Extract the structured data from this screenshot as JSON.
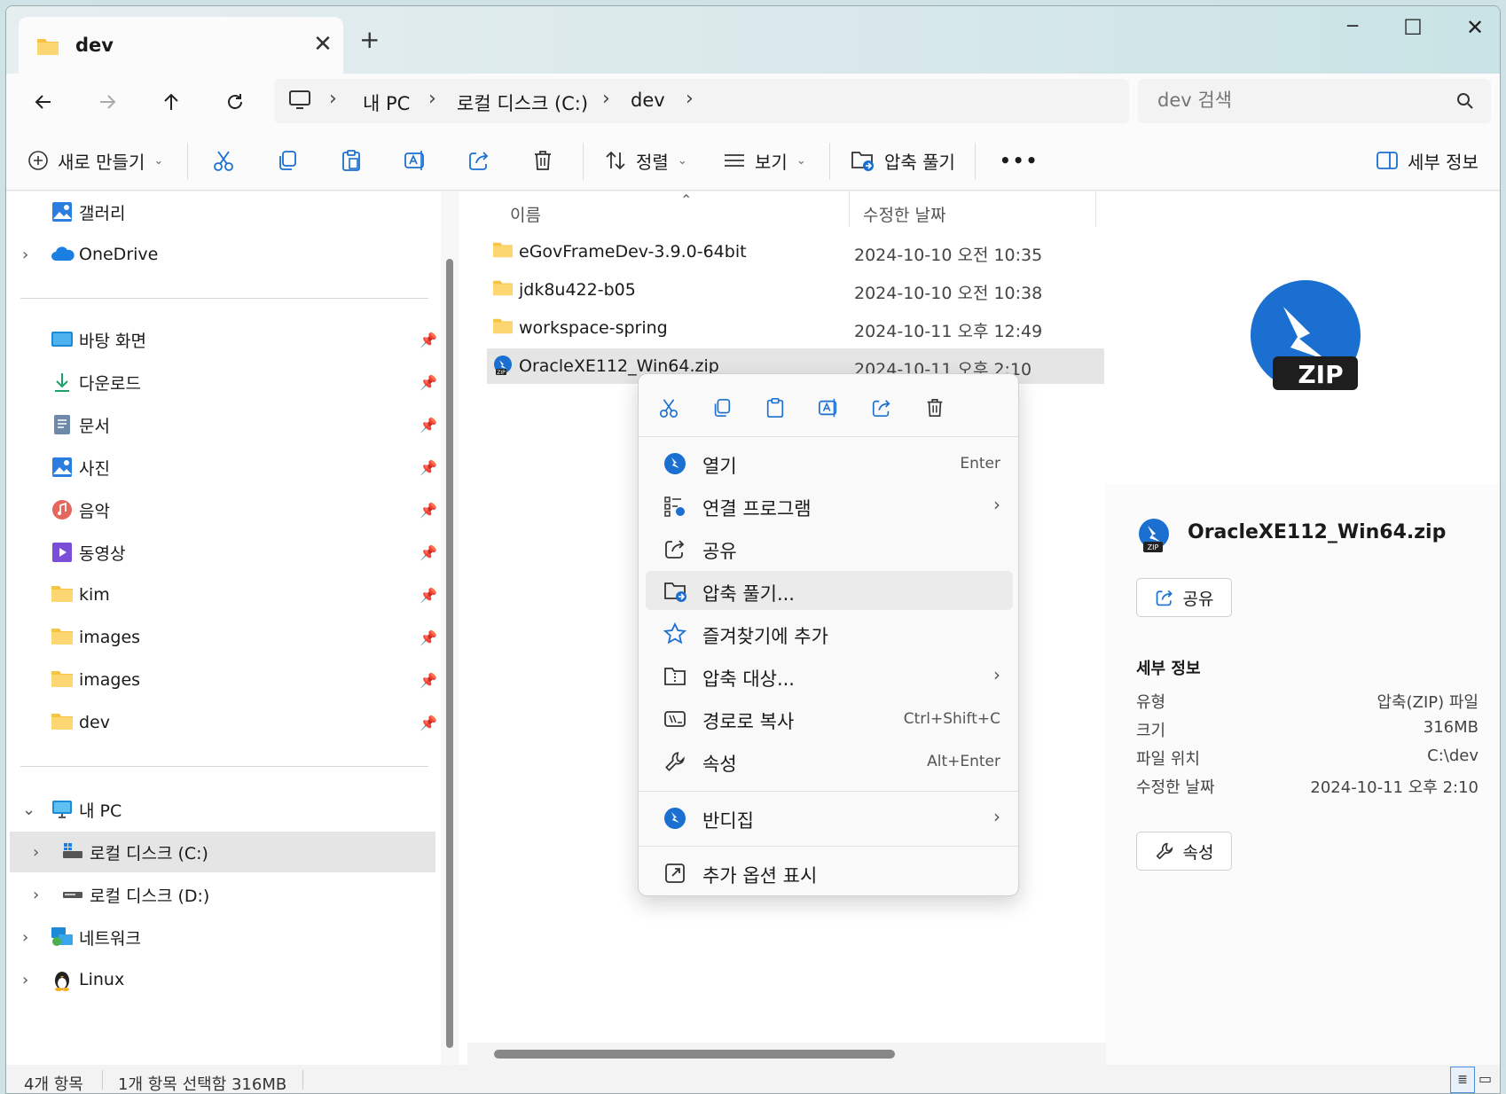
{
  "window": {
    "tab_title": "dev",
    "tab_close": "✕",
    "new_tab": "+",
    "minimize": "─",
    "maximize": "☐",
    "close": "✕"
  },
  "nav": {
    "breadcrumb": [
      "내 PC",
      "로컬 디스크 (C:)",
      "dev"
    ],
    "search_placeholder": "dev 검색"
  },
  "toolbar": {
    "new_label": "새로 만들기",
    "sort_label": "정렬",
    "view_label": "보기",
    "extract_label": "압축 풀기",
    "more_label": "•••",
    "details_label": "세부 정보"
  },
  "sidebar": {
    "top": [
      {
        "label": "갤러리"
      },
      {
        "label": "OneDrive"
      }
    ],
    "quick": [
      {
        "label": "바탕 화면"
      },
      {
        "label": "다운로드"
      },
      {
        "label": "문서"
      },
      {
        "label": "사진"
      },
      {
        "label": "음악"
      },
      {
        "label": "동영상"
      },
      {
        "label": "kim"
      },
      {
        "label": "images"
      },
      {
        "label": "images"
      },
      {
        "label": "dev"
      }
    ],
    "pc": [
      {
        "label": "내 PC"
      },
      {
        "label": "로컬 디스크 (C:)"
      },
      {
        "label": "로컬 디스크 (D:)"
      },
      {
        "label": "네트워크"
      },
      {
        "label": "Linux"
      }
    ]
  },
  "files": {
    "col_name": "이름",
    "col_date": "수정한 날짜",
    "rows": [
      {
        "name": "eGovFrameDev-3.9.0-64bit",
        "date": "2024-10-10 오전 10:35"
      },
      {
        "name": "jdk8u422-b05",
        "date": "2024-10-10 오전 10:38"
      },
      {
        "name": "workspace-spring",
        "date": "2024-10-11 오후 12:49"
      },
      {
        "name": "OracleXE112_Win64.zip",
        "date": "2024-10-11 오후 2:10"
      }
    ]
  },
  "context_menu": {
    "items": [
      {
        "label": "열기",
        "shortcut": "Enter"
      },
      {
        "label": "연결 프로그램",
        "arrow": "›"
      },
      {
        "label": "공유"
      },
      {
        "label": "압축 풀기..."
      },
      {
        "label": "즐겨찾기에 추가"
      },
      {
        "label": "압축 대상...",
        "arrow": "›"
      },
      {
        "label": "경로로 복사",
        "shortcut": "Ctrl+Shift+C"
      },
      {
        "label": "속성",
        "shortcut": "Alt+Enter"
      },
      {
        "label": "반디집",
        "arrow": "›"
      },
      {
        "label": "추가 옵션 표시"
      }
    ]
  },
  "details": {
    "preview_badge": "ZIP",
    "file_badge": "ZIP",
    "file_name": "OracleXE112_Win64.zip",
    "share_label": "공유",
    "section_title": "세부 정보",
    "props": [
      {
        "key": "유형",
        "value": "압축(ZIP) 파일"
      },
      {
        "key": "크기",
        "value": "316MB"
      },
      {
        "key": "파일 위치",
        "value": "C:\\dev"
      },
      {
        "key": "수정한 날짜",
        "value": "2024-10-11 오후 2:10"
      }
    ],
    "properties_label": "속성"
  },
  "status": {
    "count": "4개 항목",
    "selection": "1개 항목 선택함 316MB"
  },
  "colors": {
    "accent": "#0067c0",
    "folder": "#f6c343",
    "bandizip_blue": "#1a6fd1"
  }
}
